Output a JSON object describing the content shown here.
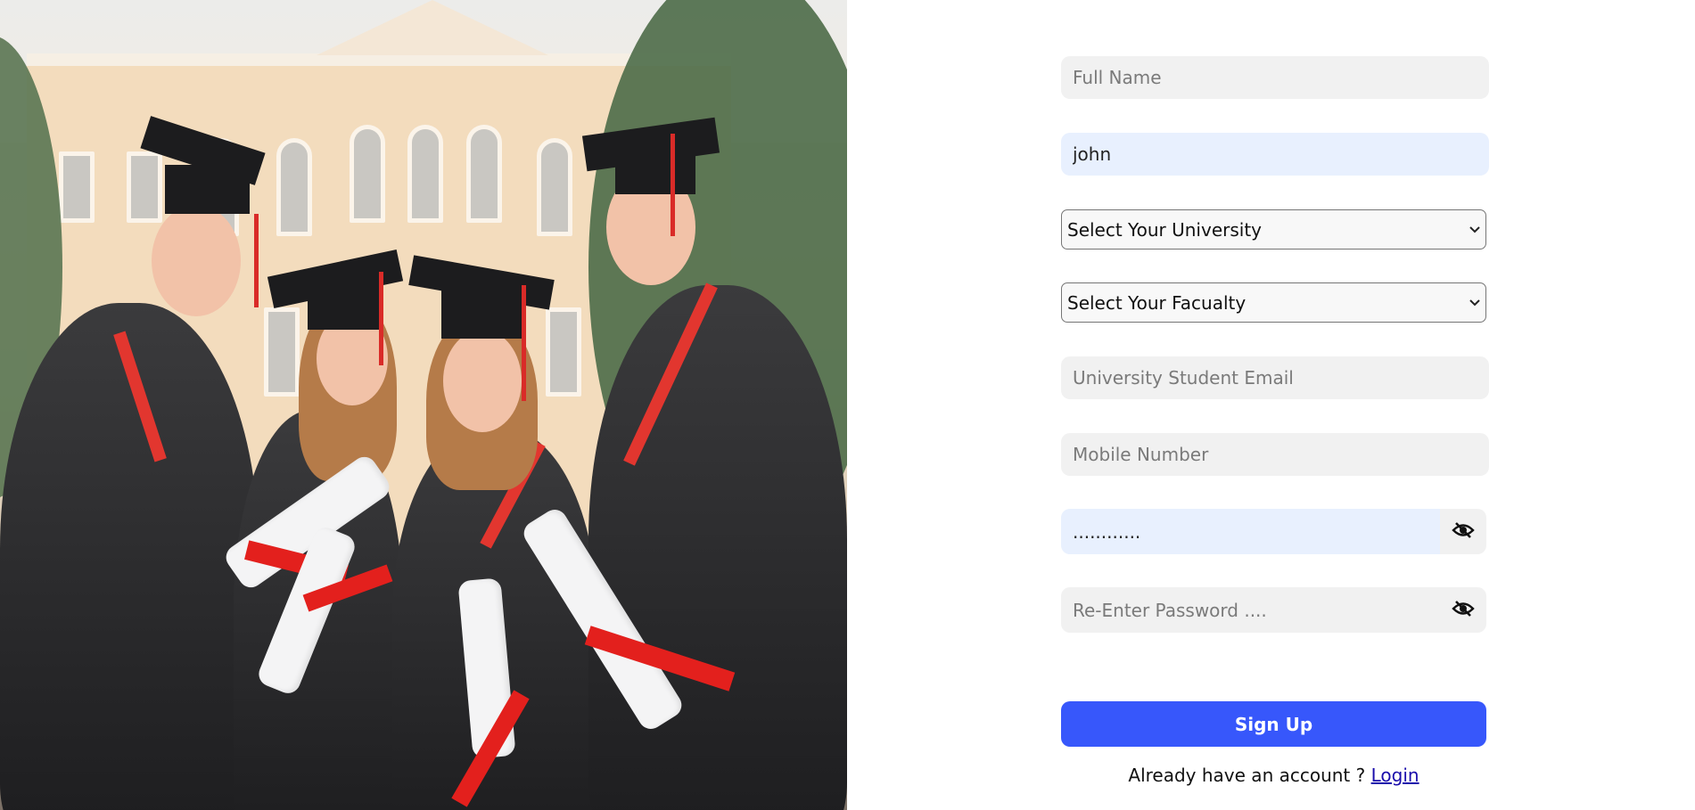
{
  "form": {
    "full_name": {
      "placeholder": "Full Name",
      "value": ""
    },
    "username": {
      "value": "john"
    },
    "university_select": {
      "selected": "Select Your University"
    },
    "faculty_select": {
      "selected": "Select Your Facualty"
    },
    "email": {
      "placeholder": "University Student Email",
      "value": ""
    },
    "mobile": {
      "placeholder": "Mobile Number",
      "value": ""
    },
    "password": {
      "value": "............"
    },
    "reenter_password": {
      "placeholder": "Re-Enter Password ....",
      "value": ""
    },
    "signup_label": "Sign Up",
    "login_prompt": "Already have an account ? ",
    "login_link": "Login"
  },
  "icons": {
    "password_toggle": "eye-slash-icon",
    "select_arrow": "chevron-down-icon"
  },
  "colors": {
    "primary": "#3757fb",
    "autofill": "#e8f0fe",
    "field_bg": "#f1f1f1"
  }
}
